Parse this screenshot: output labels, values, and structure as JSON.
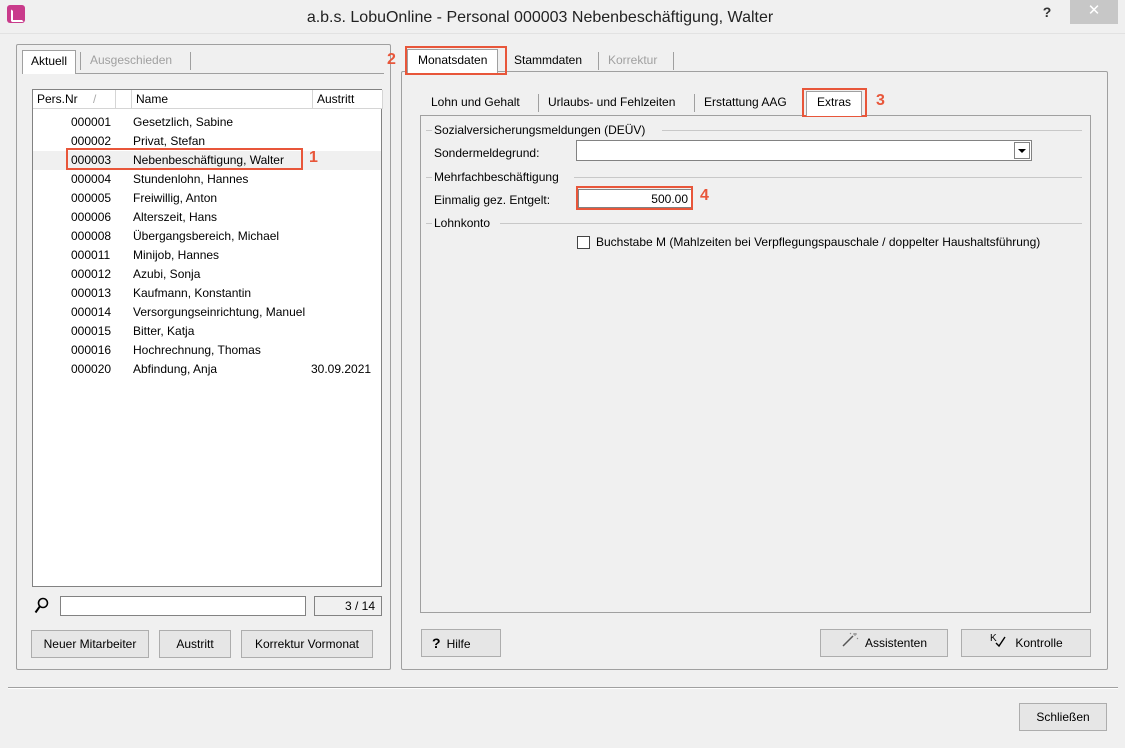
{
  "window": {
    "title": "a.b.s. LobuOnline - Personal 000003 Nebenbeschäftigung, Walter",
    "help_label": "?",
    "close_label": "✕"
  },
  "left": {
    "tabs": [
      {
        "label": "Aktuell",
        "state": "selected"
      },
      {
        "label": "Ausgeschieden",
        "state": "disabled"
      }
    ],
    "columns": {
      "pers_nr": "Pers.Nr",
      "sort_mark": "/",
      "name": "Name",
      "austritt": "Austritt"
    },
    "rows": [
      {
        "nr": "000001",
        "name": "Gesetzlich, Sabine",
        "austritt": ""
      },
      {
        "nr": "000002",
        "name": "Privat, Stefan",
        "austritt": ""
      },
      {
        "nr": "000003",
        "name": "Nebenbeschäftigung, Walter",
        "austritt": "",
        "selected": true
      },
      {
        "nr": "000004",
        "name": "Stundenlohn, Hannes",
        "austritt": ""
      },
      {
        "nr": "000005",
        "name": "Freiwillig, Anton",
        "austritt": ""
      },
      {
        "nr": "000006",
        "name": "Alterszeit, Hans",
        "austritt": ""
      },
      {
        "nr": "000008",
        "name": "Übergangsbereich, Michael",
        "austritt": ""
      },
      {
        "nr": "000011",
        "name": "Minijob, Hannes",
        "austritt": ""
      },
      {
        "nr": "000012",
        "name": "Azubi, Sonja",
        "austritt": ""
      },
      {
        "nr": "000013",
        "name": "Kaufmann, Konstantin",
        "austritt": ""
      },
      {
        "nr": "000014",
        "name": "Versorgungseinrichtung, Manuel",
        "austritt": ""
      },
      {
        "nr": "000015",
        "name": "Bitter, Katja",
        "austritt": ""
      },
      {
        "nr": "000016",
        "name": "Hochrechnung, Thomas",
        "austritt": ""
      },
      {
        "nr": "000020",
        "name": "Abfindung, Anja",
        "austritt": "30.09.2021"
      }
    ],
    "search_value": "",
    "count": "3 / 14",
    "buttons": {
      "new": "Neuer Mitarbeiter",
      "austritt": "Austritt",
      "korrektur": "Korrektur Vormonat"
    }
  },
  "right": {
    "tabs": [
      {
        "label": "Monatsdaten",
        "state": "selected"
      },
      {
        "label": "Stammdaten",
        "state": "normal"
      },
      {
        "label": "Korrektur",
        "state": "disabled"
      }
    ],
    "subtabs": [
      "Lohn und Gehalt",
      "Urlaubs- und Fehlzeiten",
      "Erstattung AAG",
      "Extras"
    ],
    "groups": {
      "sv": "Sozialversicherungsmeldungen (DEÜV)",
      "mehrfach": "Mehrfachbeschäftigung",
      "lohnkonto": "Lohnkonto"
    },
    "fields": {
      "sondermeldegrund_label": "Sondermeldegrund:",
      "sondermeldegrund_value": "",
      "einmalig_label": "Einmalig gez. Entgelt:",
      "einmalig_value": "500.00",
      "buchstabe_m_label": "Buchstabe M (Mahlzeiten bei Verpflegungspauschale / doppelter Haushaltsführung)",
      "buchstabe_m_checked": false
    },
    "buttons": {
      "hilfe": "Hilfe",
      "hilfe_icon": "?",
      "assistenten": "Assistenten",
      "kontrolle": "Kontrolle"
    }
  },
  "annotations": {
    "n1": "1",
    "n2": "2",
    "n3": "3",
    "n4": "4",
    "color": "#e8563a"
  },
  "footer": {
    "schliessen": "Schließen"
  }
}
